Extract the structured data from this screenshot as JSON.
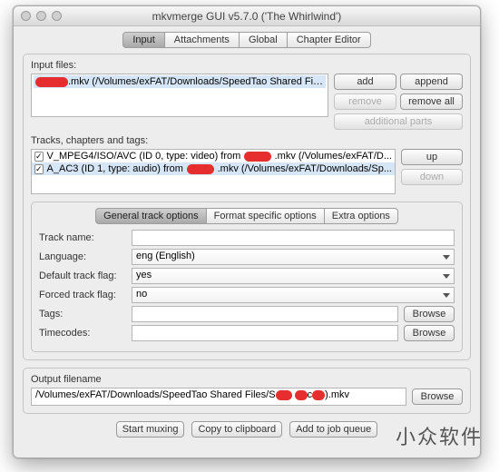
{
  "window": {
    "title": "mkvmerge GUI v5.7.0 ('The Whirlwind')"
  },
  "main_tabs": [
    "Input",
    "Attachments",
    "Global",
    "Chapter Editor"
  ],
  "labels": {
    "input_files": "Input files:",
    "tracks": "Tracks, chapters and tags:",
    "output": "Output filename"
  },
  "buttons": {
    "add": "add",
    "append": "append",
    "remove": "remove",
    "remove_all": "remove all",
    "additional": "additional parts",
    "up": "up",
    "down": "down",
    "browse": "Browse",
    "start": "Start muxing",
    "copy": "Copy to clipboard",
    "queue": "Add to job queue"
  },
  "input_file": {
    "suffix": ".mkv (/Volumes/exFAT/Downloads/SpeedTao Shared Files)"
  },
  "tracks": [
    {
      "checked": true,
      "pre": "V_MPEG4/ISO/AVC (ID 0, type: video) from ",
      "mid": ".mkv (/Volumes/exFAT/D..."
    },
    {
      "checked": true,
      "pre": "A_AC3 (ID 1, type: audio) from ",
      "mid": ".mkv (/Volumes/exFAT/Downloads/Sp..."
    }
  ],
  "opt_tabs": [
    "General track options",
    "Format specific options",
    "Extra options"
  ],
  "form": {
    "track_name_label": "Track name:",
    "track_name": "",
    "language_label": "Language:",
    "language": "eng (English)",
    "default_label": "Default track flag:",
    "default": "yes",
    "forced_label": "Forced track flag:",
    "forced": "no",
    "tags_label": "Tags:",
    "tags": "",
    "timecodes_label": "Timecodes:",
    "timecodes": ""
  },
  "output": {
    "pre": "/Volumes/exFAT/Downloads/SpeedTao Shared Files/S",
    "post": ").mkv"
  },
  "watermark": "小众软件"
}
